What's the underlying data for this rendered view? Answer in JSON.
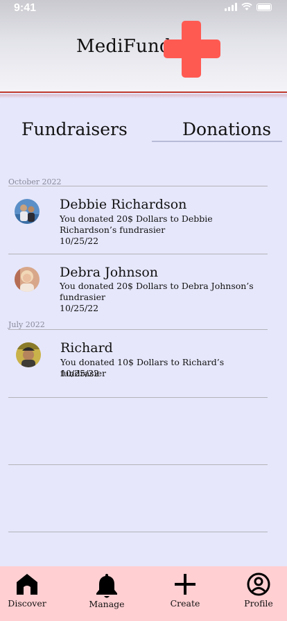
{
  "status_bar": {
    "time": "9:41"
  },
  "header": {
    "title": "MediFund",
    "logo_icon": "red-cross-icon"
  },
  "tabs": [
    {
      "label": "Fundraisers",
      "active": false
    },
    {
      "label": "Donations",
      "active": true
    }
  ],
  "sections": [
    {
      "label": "October 2022"
    },
    {
      "label": "July 2022"
    }
  ],
  "donations": [
    {
      "name": "Debbie Richardson",
      "message": "You donated 20$ Dollars to Debbie Richardson’s fundrasier",
      "date": "10/25/22"
    },
    {
      "name": "Debra Johnson",
      "message": "You donated 20$ Dollars to Debra Johnson’s fundrasier",
      "date": "10/25/22"
    },
    {
      "name": "Richard",
      "message": "You donated 10$ Dollars to Richard’s  fundrasier",
      "date": "10/25/22"
    }
  ],
  "nav": [
    {
      "label": "Discover",
      "icon": "home-icon"
    },
    {
      "label": "Manage",
      "icon": "bell-icon"
    },
    {
      "label": "Create",
      "icon": "plus-icon"
    },
    {
      "label": "Profile",
      "icon": "profile-icon"
    }
  ],
  "colors": {
    "accent": "#ff5a52",
    "background": "#e6e7fb",
    "nav_background": "#ffcfd2",
    "header_line": "#c0392b"
  }
}
